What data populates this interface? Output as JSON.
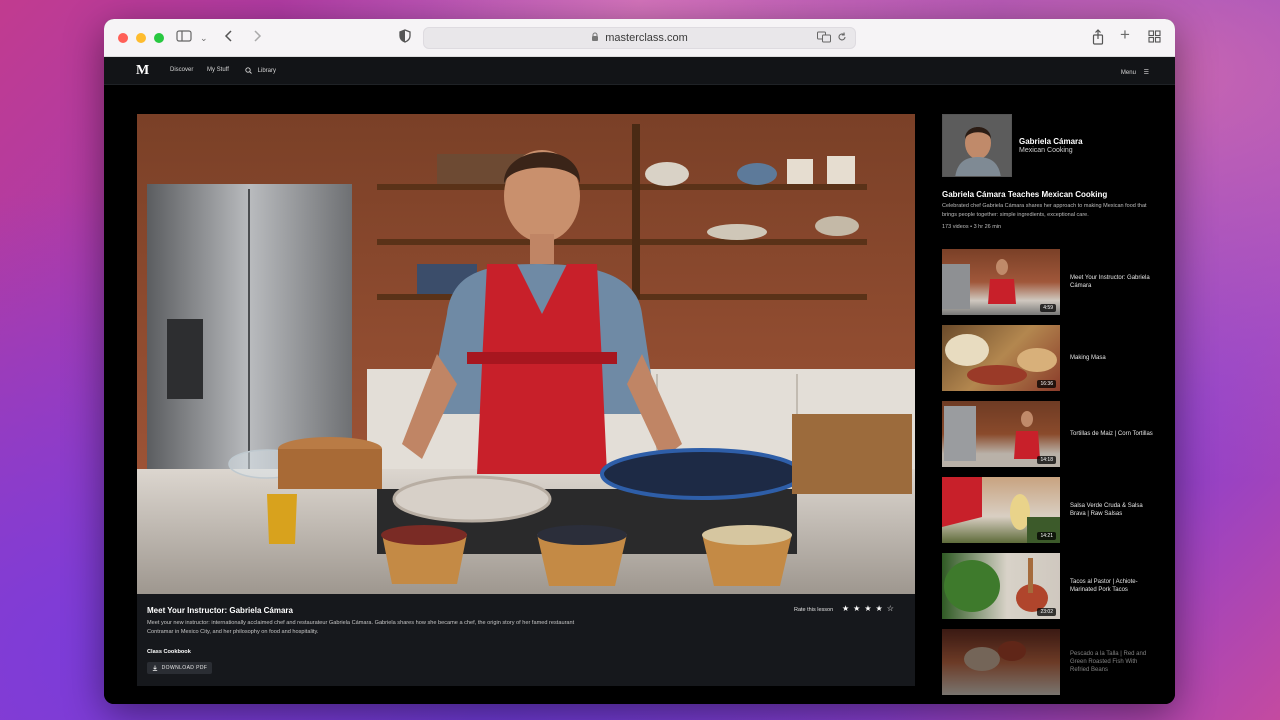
{
  "browser": {
    "url": "masterclass.com"
  },
  "site": {
    "logo": "M",
    "nav": {
      "discover": "Discover",
      "my_stuff": "My Stuff",
      "library": "Library",
      "menu": "Menu"
    }
  },
  "lesson": {
    "title": "Meet Your Instructor: Gabriela Cámara",
    "description": "Meet your new instructor: internationally acclaimed chef and restaurateur Gabriela Cámara. Gabriela shares how she became a chef, the origin story of her famed restaurant Contramar in Mexico City, and her philosophy on food and hospitality.",
    "rate_label": "Rate this lesson",
    "rating": 4,
    "stars": [
      "★",
      "★",
      "★",
      "★",
      "☆"
    ],
    "cookbook_label": "Class Cookbook",
    "download_label": "DOWNLOAD PDF"
  },
  "instructor": {
    "name": "Gabriela Cámara",
    "subject": "Mexican Cooking"
  },
  "class": {
    "title": "Gabriela Cámara Teaches Mexican Cooking",
    "description": "Celebrated chef Gabriela Cámara shares her approach to making Mexican food that brings people together: simple ingredients, exceptional care.",
    "meta": "173 videos • 3 hr 26 min"
  },
  "lessons": [
    {
      "title": "Meet Your Instructor: Gabriela Cámara",
      "duration": "4:59"
    },
    {
      "title": "Making Masa",
      "duration": "16:36"
    },
    {
      "title": "Tortillas de Maiz | Corn Tortillas",
      "duration": "14:18"
    },
    {
      "title": "Salsa Verde Cruda & Salsa Brava | Raw Salsas",
      "duration": "14:21"
    },
    {
      "title": "Tacos al Pastor | Achiote-Marinated Pork Tacos",
      "duration": "23:02"
    },
    {
      "title": "Pescado a la Talla | Red and Green Roasted Fish With Refried Beans",
      "duration": ""
    }
  ],
  "colors": {
    "accent_apron": "#c8202a",
    "background": "#000000",
    "panel": "#16181c"
  }
}
